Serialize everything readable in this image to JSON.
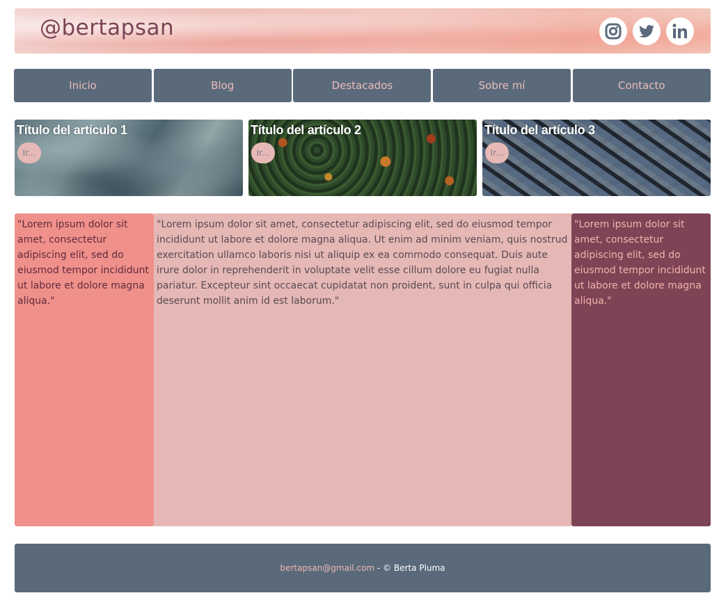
{
  "header": {
    "brand": "@bertapsan",
    "social": [
      {
        "name": "instagram",
        "icon": "instagram-icon"
      },
      {
        "name": "twitter",
        "icon": "twitter-icon"
      },
      {
        "name": "linkedin",
        "icon": "linkedin-icon"
      }
    ]
  },
  "nav": {
    "items": [
      {
        "label": "Inicio"
      },
      {
        "label": "Blog"
      },
      {
        "label": "Destacados"
      },
      {
        "label": "Sobre mí"
      },
      {
        "label": "Contacto"
      }
    ]
  },
  "articles": [
    {
      "title": "Título del artículo 1",
      "button": "Ir..."
    },
    {
      "title": "Título del artículo 2",
      "button": "Ir..."
    },
    {
      "title": "Título del artículo 3",
      "button": "Ir..."
    }
  ],
  "main": {
    "left": "\"Lorem ipsum dolor sit amet, consectetur adipiscing elit, sed do eiusmod tempor incididunt ut labore et dolore magna aliqua.\"",
    "center": "\"Lorem ipsum dolor sit amet, consectetur adipiscing elit, sed do eiusmod tempor incididunt ut labore et dolore magna aliqua. Ut enim ad minim veniam, quis nostrud exercitation ullamco laboris nisi ut aliquip ex ea commodo consequat. Duis aute irure dolor in reprehenderit in voluptate velit esse cillum dolore eu fugiat nulla pariatur. Excepteur sint occaecat cupidatat non proident, sunt in culpa qui officia deserunt mollit anim id est laborum.\"",
    "right": "\"Lorem ipsum dolor sit amet, consectetur adipiscing elit, sed do eiusmod tempor incididunt ut labore et dolore magna aliqua.\""
  },
  "footer": {
    "email": "bertapsan@gmail.com",
    "copyright": " - © Berta Pluma"
  },
  "colors": {
    "nav": "#5a6a7b",
    "nav_text": "#ecbdb9",
    "left_col": "#f0908a",
    "center_col": "#e5b8b5",
    "right_col": "#7e4455",
    "brand": "#7b4454"
  }
}
